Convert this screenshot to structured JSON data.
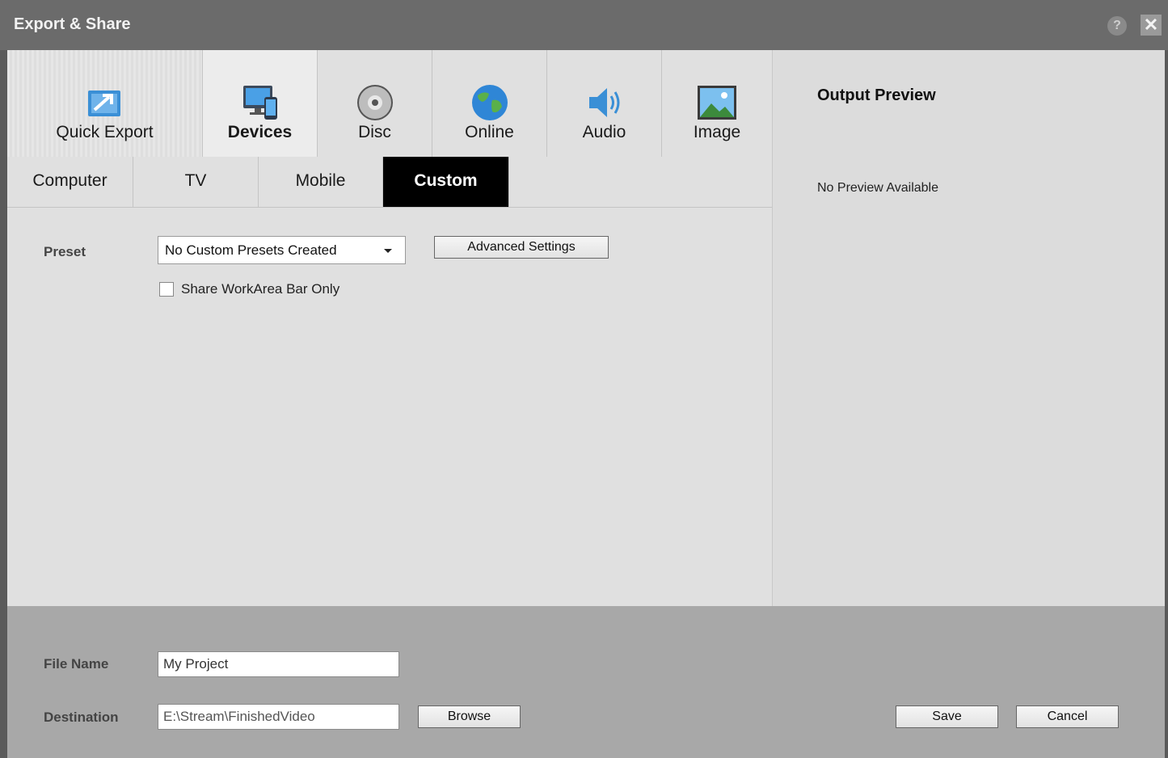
{
  "window": {
    "title": "Export & Share"
  },
  "categories": [
    {
      "label": "Quick Export",
      "icon": "quick-export-icon"
    },
    {
      "label": "Devices",
      "icon": "devices-icon"
    },
    {
      "label": "Disc",
      "icon": "disc-icon"
    },
    {
      "label": "Online",
      "icon": "globe-icon"
    },
    {
      "label": "Audio",
      "icon": "speaker-icon"
    },
    {
      "label": "Image",
      "icon": "image-icon"
    }
  ],
  "active_category": "Devices",
  "subtabs": [
    {
      "label": "Computer"
    },
    {
      "label": "TV"
    },
    {
      "label": "Mobile"
    },
    {
      "label": "Custom"
    }
  ],
  "active_subtab": "Custom",
  "settings": {
    "preset_label": "Preset",
    "preset_value": "No Custom Presets Created",
    "advanced_label": "Advanced Settings",
    "share_workarea_label": "Share WorkArea Bar Only",
    "share_workarea_checked": false
  },
  "preview": {
    "title": "Output Preview",
    "message": "No Preview Available"
  },
  "footer": {
    "filename_label": "File Name",
    "filename_value": "My Project",
    "destination_label": "Destination",
    "destination_value": "E:\\Stream\\FinishedVideo",
    "browse_label": "Browse",
    "save_label": "Save",
    "cancel_label": "Cancel"
  },
  "colors": {
    "titlebar": "#6b6b6b",
    "panel": "#e0e0e0",
    "footer": "#a8a8a8",
    "active_subtab_bg": "#000000",
    "icon_blue": "#3a8fd6"
  }
}
